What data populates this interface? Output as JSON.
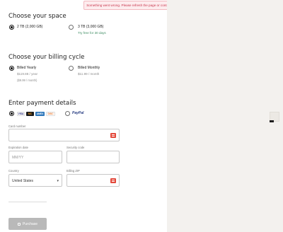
{
  "error_banner": {
    "text": "Something went wrong. Please refresh the page or contact customer support."
  },
  "space": {
    "heading": "Choose your space",
    "options": [
      {
        "label": "2 TB (2,000 GB)",
        "selected": true
      },
      {
        "label": "3 TB (3,000 GB)",
        "note": "Try free for 30 days",
        "selected": false
      }
    ]
  },
  "billing": {
    "heading": "Choose your billing cycle",
    "options": [
      {
        "label": "Billed Yearly",
        "price": "$119.88 / year",
        "per_month": "($9.99 / month)",
        "selected": true
      },
      {
        "label": "Billed Monthly",
        "price": "$11.99 / month",
        "selected": false
      }
    ]
  },
  "payment": {
    "heading": "Enter payment details",
    "methods": {
      "cards": [
        "VISA",
        "MC",
        "AMEX",
        "DISC"
      ],
      "paypal": "PayPal",
      "cards_selected": true
    },
    "card_number_label": "Card number",
    "expiration_label": "Expiration date",
    "expiration_placeholder": "MM/YY",
    "security_label": "Security code",
    "country_label": "Country",
    "country_value": "United States",
    "zip_label": "Billing ZIP"
  },
  "purchase_button": "Purchase",
  "colors": {
    "accent_error": "#e0455e",
    "button_disabled": "#b9b9b9",
    "right_panel": "#f3f1ee"
  }
}
